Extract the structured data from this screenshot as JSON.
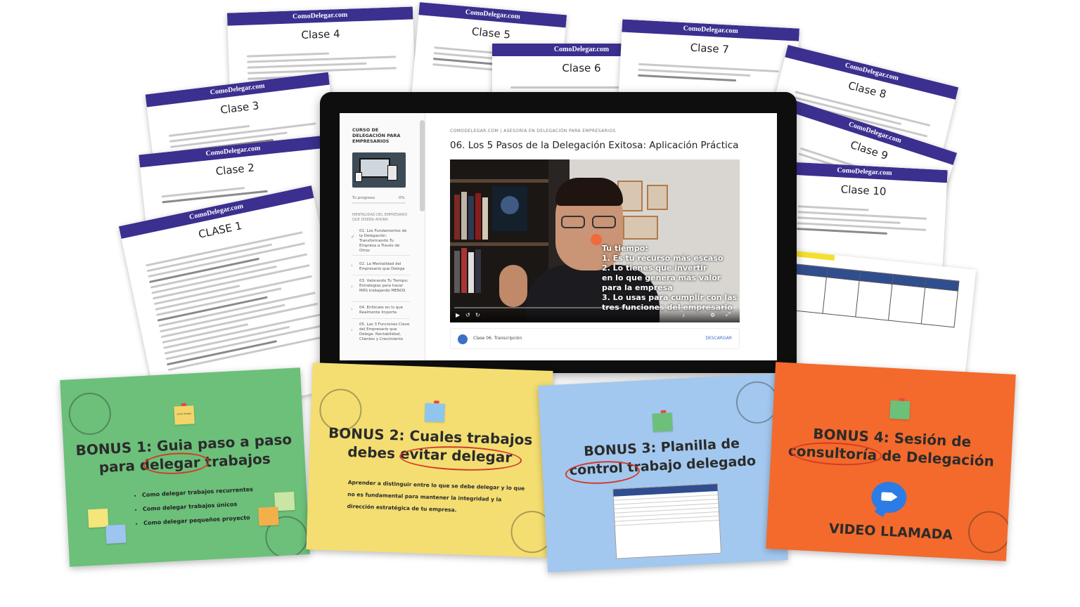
{
  "brand": "ComoDelegar.com",
  "classes": {
    "c1": "CLASE 1",
    "c2": "Clase 2",
    "c3": "Clase 3",
    "c4": "Clase 4",
    "c5": "Clase 5",
    "c6": "Clase 6",
    "c7": "Clase 7",
    "c8": "Clase 8",
    "c9": "Clase 9",
    "c10": "Clase 10"
  },
  "course": {
    "sidebar_title": "CURSO DE DELEGACIÓN PARA EMPRESARIOS",
    "progress_label": "Tu progreso",
    "progress_value": "0%",
    "section": "MENTALIDAD DEL EMPRESARIO QUE DISEÑA AHORA",
    "lessons": [
      {
        "label": "01. Los Fundamentos de la Delegación: Transformando Tu Empresa a Través de Otros",
        "done": "✓"
      },
      {
        "label": "02. La Mentalidad del Empresario que Delega",
        "done": "›"
      },
      {
        "label": "03. Valorando Tu Tiempo: Estrategias para hacer MÁS trabajando MENOS",
        "done": "›"
      },
      {
        "label": "04. Enfócate en lo que Realmente Importa",
        "done": "›"
      },
      {
        "label": "05. Las 3 Funciones Clave del Empresario que Delega: Rentabilidad, Clientes y Crecimiento",
        "done": "›"
      }
    ],
    "breadcrumb": "COMODELEGAR.COM | ASESORÍA EN DELEGACIÓN PARA EMPRESARIOS",
    "lesson_title": "06. Los 5 Pasos de la Delegación Exitosa: Aplicación Práctica",
    "video_overlay": [
      "Tu tiempo:",
      "1. Es tu recurso más escaso",
      "2. Lo tienes que invertir",
      "en lo que genera más valor",
      "para la empresa",
      "3. Lo usas para cumplir con las",
      "tres funciones del empresario"
    ],
    "transcript_label": "Clase 06. Transcripción",
    "download_label": "DESCARGAR"
  },
  "bonuses": {
    "b1": {
      "title_line1": "BONUS 1: Guia paso a paso",
      "title_line2": "para delegar trabajos",
      "items": [
        "Como delegar trabajos recurrentes",
        "Como delegar trabajos únicos",
        "Como delegar pequeños proyecto"
      ],
      "note_label": "Como delegar"
    },
    "b2": {
      "title_line1": "BONUS 2: Cuales trabajos",
      "title_line2": "debes evitar delegar",
      "desc": [
        "Aprender a distinguir entre lo que se debe delegar y lo que",
        "no es fundamental para mantener la integridad y la",
        "dirección estratégica de tu empresa."
      ]
    },
    "b3": {
      "title_line1": "BONUS 3: Planilla de",
      "title_line2": "control trabajo delegado"
    },
    "b4": {
      "title_line1": "BONUS 4: Sesión de",
      "title_line2": "consultoría de Delegación",
      "call": "VIDEO LLAMADA"
    }
  },
  "colors": {
    "brand_band": "#3b2f8f",
    "bonus1_bg": "#6cc07a",
    "bonus2_bg": "#f4de72",
    "bonus3_bg": "#a3c8ef",
    "bonus4_bg": "#f36a2c",
    "accent_circle": "#d23a2a"
  }
}
